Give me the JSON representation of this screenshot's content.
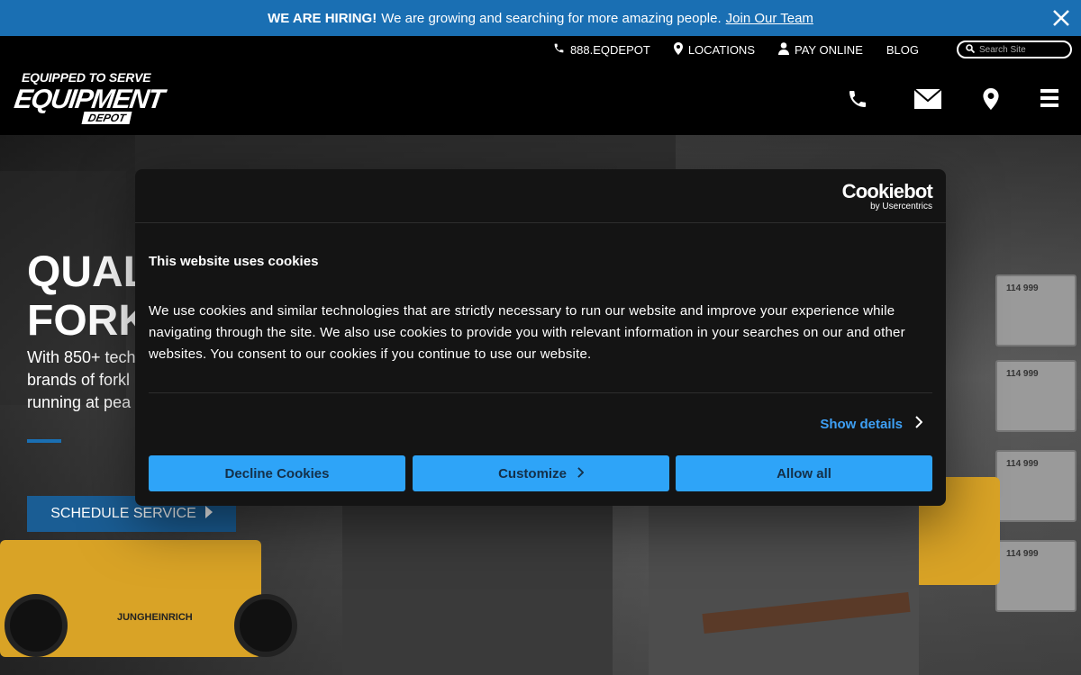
{
  "banner": {
    "bold": "WE ARE HIRING!",
    "text": "We are growing and searching for more amazing people.",
    "link": "Join Our Team"
  },
  "utility": {
    "phone": "888.EQDEPOT",
    "locations": "LOCATIONS",
    "pay": "PAY ONLINE",
    "blog": "BLOG",
    "search_placeholder": "Search Site"
  },
  "logo": {
    "tagline": "EQUIPPED TO SERVE",
    "main": "EQUIPMENT",
    "sub": "DEPOT"
  },
  "hero": {
    "title_line1": "QUAL",
    "title_line2": "FORK",
    "text_line1": "With 850+ tech",
    "text_line2": "brands of forkl",
    "text_line3": "running at pea",
    "cta": "SCHEDULE SERVICE",
    "forklift_brand": "JUNGHEINRICH",
    "crate_label": "114 999"
  },
  "cookie": {
    "brand": "Cookiebot",
    "brand_sub": "by Usercentrics",
    "title": "This website uses cookies",
    "body": "We use cookies and similar technologies that are strictly necessary to run our website and improve your experience while navigating through the site. We also use cookies to provide you with relevant information in your searches on our and other websites. You consent to our cookies if you continue to use our website.",
    "details": "Show details",
    "decline": "Decline Cookies",
    "customize": "Customize",
    "allow": "Allow all"
  },
  "colors": {
    "banner": "#1a6fb3",
    "button_accent": "#2ea4f8",
    "link_accent": "#3ea0f5",
    "dialog_bg": "#141414"
  },
  "icons": [
    "close-icon",
    "phone-icon",
    "location-pin-icon",
    "user-icon",
    "search-icon",
    "envelope-icon",
    "menu-icon",
    "chevron-right-icon"
  ]
}
